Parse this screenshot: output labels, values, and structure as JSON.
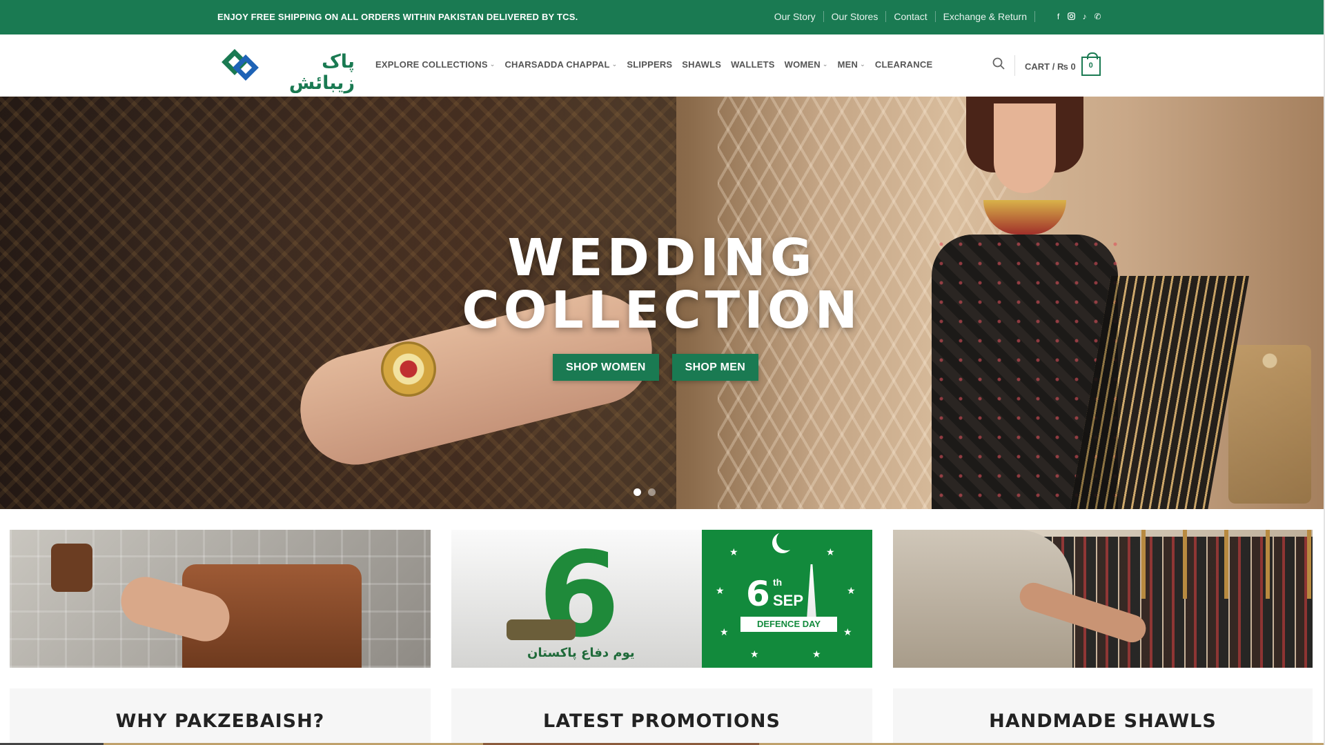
{
  "topbar": {
    "promo": "ENJOY FREE SHIPPING ON ALL ORDERS WITHIN PAKISTAN DELIVERED BY TCS.",
    "links": [
      "Our Story",
      "Our Stores",
      "Contact",
      "Exchange & Return"
    ],
    "social_icons": [
      "facebook-icon",
      "instagram-icon",
      "tiktok-icon",
      "phone-icon"
    ]
  },
  "header": {
    "logo_text": "پاک زیبائش",
    "nav": [
      {
        "label": "EXPLORE COLLECTIONS",
        "dropdown": true
      },
      {
        "label": "CHARSADDA CHAPPAL",
        "dropdown": true
      },
      {
        "label": "SLIPPERS",
        "dropdown": false
      },
      {
        "label": "SHAWLS",
        "dropdown": false
      },
      {
        "label": "WALLETS",
        "dropdown": false
      },
      {
        "label": "WOMEN",
        "dropdown": true
      },
      {
        "label": "MEN",
        "dropdown": true
      },
      {
        "label": "CLEARANCE",
        "dropdown": false
      }
    ],
    "cart_label": "CART / ₨ 0",
    "cart_count": "0"
  },
  "hero": {
    "title_line1": "WEDDING",
    "title_line2": "COLLECTION",
    "button_women": "SHOP WOMEN",
    "button_men": "SHOP MEN",
    "slide_count": 2,
    "active_slide": 0
  },
  "tiles": {
    "defence_six": "6",
    "defence_th": "th",
    "defence_urdu": "یوم دفاع پاکستان",
    "defence_sep": "SEP",
    "defence_day": "DEFENCE DAY"
  },
  "cards": {
    "why": "WHY PAKZEBAISH?",
    "promotions": "LATEST PROMOTIONS",
    "shawls": "HANDMADE SHAWLS"
  },
  "colors": {
    "brand_green": "#1a7a52",
    "defence_green": "#128a3c"
  }
}
